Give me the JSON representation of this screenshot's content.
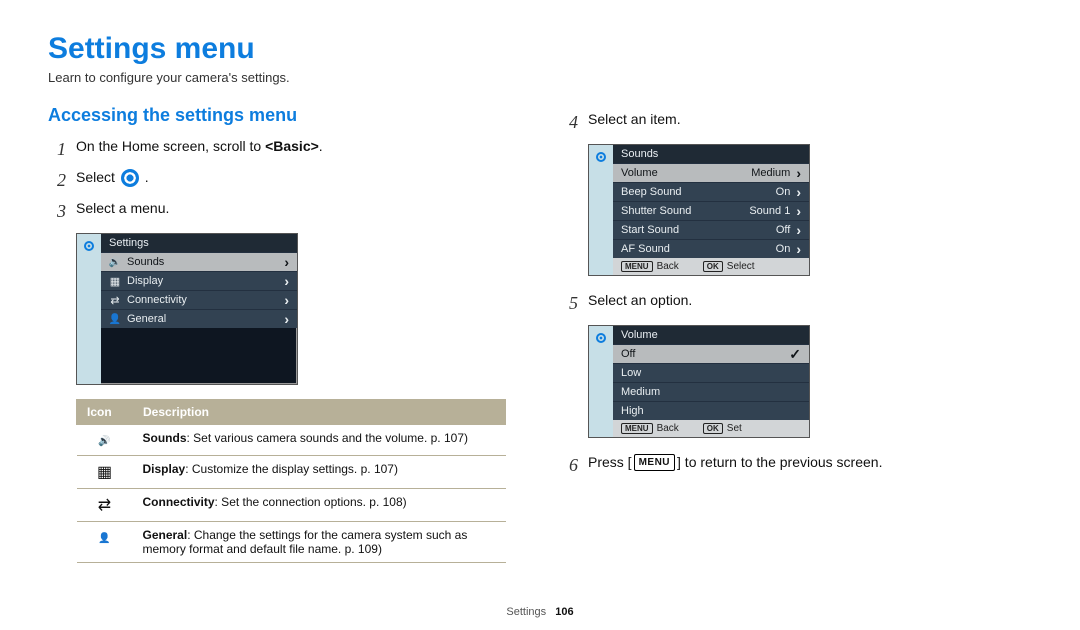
{
  "page": {
    "title": "Settings menu",
    "subtitle": "Learn to configure your camera's settings.",
    "section_title": "Accessing the settings menu",
    "footer_section": "Settings",
    "footer_page": "106",
    "basic_bold": "<Basic>"
  },
  "steps": {
    "1": "On the Home screen, scroll to ",
    "2": "Select ",
    "3": "Select a menu.",
    "4": "Select an item.",
    "5": "Select an option.",
    "6a": "Press [",
    "6b": "] to return to the previous screen.",
    "menu_label": "MENU",
    "period": "."
  },
  "screen1": {
    "header": "Settings",
    "items": [
      {
        "label": "Sounds",
        "icon": "sound",
        "selected": true
      },
      {
        "label": "Display",
        "icon": "display"
      },
      {
        "label": "Connectivity",
        "icon": "conn"
      },
      {
        "label": "General",
        "icon": "general"
      }
    ]
  },
  "icon_table": {
    "head_icon": "Icon",
    "head_desc": "Description",
    "rows": [
      {
        "icon": "sound",
        "name": "Sounds",
        "rest": ": Set various camera sounds and the volume. p. 107)"
      },
      {
        "icon": "display",
        "name": "Display",
        "rest": ": Customize the display settings. p. 107)"
      },
      {
        "icon": "conn",
        "name": "Connectivity",
        "rest": ": Set the connection options. p. 108)"
      },
      {
        "icon": "general",
        "name": "General",
        "rest": ": Change the settings for the camera system such as memory format and default file name. p. 109)"
      }
    ]
  },
  "screen2": {
    "header": "Sounds",
    "items": [
      {
        "label": "Volume",
        "value": "Medium",
        "selected": true
      },
      {
        "label": "Beep Sound",
        "value": "On"
      },
      {
        "label": "Shutter Sound",
        "value": "Sound 1"
      },
      {
        "label": "Start Sound",
        "value": "Off"
      },
      {
        "label": "AF Sound",
        "value": "On"
      }
    ],
    "footer": {
      "back": "Back",
      "select": "Select",
      "menu_key": "MENU",
      "ok_key": "OK"
    }
  },
  "screen3": {
    "header": "Volume",
    "items": [
      {
        "label": "Off",
        "selected": true,
        "checked": true
      },
      {
        "label": "Low"
      },
      {
        "label": "Medium"
      },
      {
        "label": "High"
      }
    ],
    "footer": {
      "back": "Back",
      "set": "Set",
      "menu_key": "MENU",
      "ok_key": "OK"
    }
  }
}
